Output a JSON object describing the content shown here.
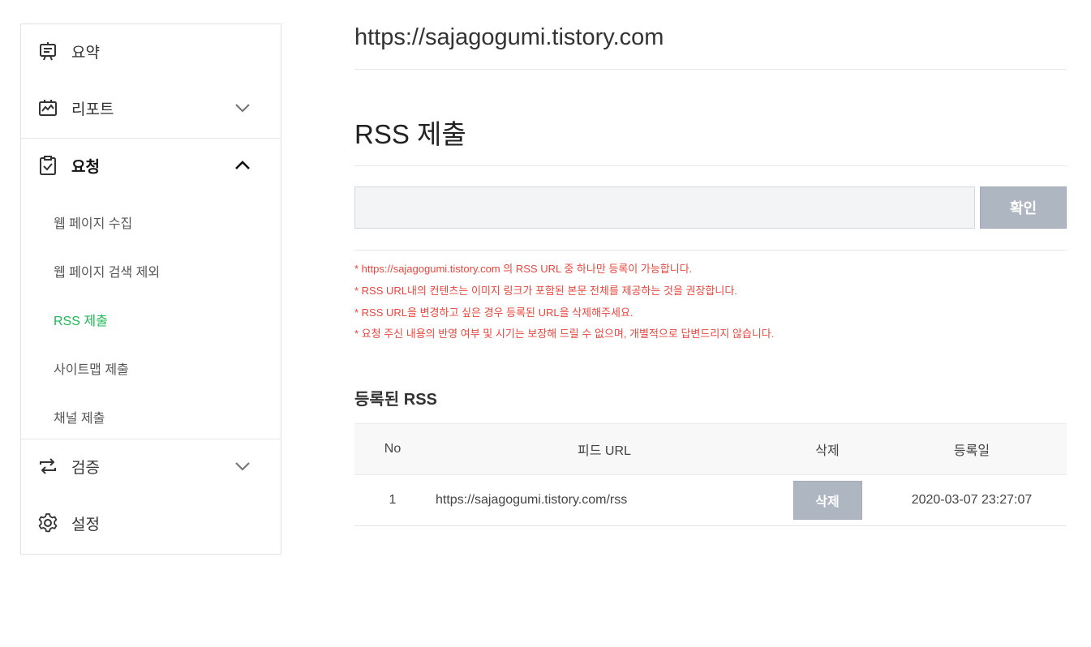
{
  "sidebar": {
    "items": [
      {
        "label": "요약",
        "icon": "presentation-board-icon"
      },
      {
        "label": "리포트",
        "icon": "chart-report-icon"
      },
      {
        "label": "요청",
        "icon": "clipboard-check-icon",
        "expanded": true
      },
      {
        "label": "검증",
        "icon": "repeat-arrows-icon"
      },
      {
        "label": "설정",
        "icon": "gear-icon"
      }
    ],
    "subitems": [
      "웹 페이지 수집",
      "웹 페이지 검색 제외",
      "RSS 제출",
      "사이트맵 제출",
      "채널 제출"
    ],
    "current_subitem_color": "#1db954"
  },
  "main": {
    "site_url": "https://sajagogumi.tistory.com",
    "page_title": "RSS 제출",
    "input": {
      "value": "",
      "placeholder": ""
    },
    "confirm_label": "확인",
    "notices": [
      "* https://sajagogumi.tistory.com 의 RSS URL 중 하나만 등록이 가능합니다.",
      "* RSS URL내의 컨텐츠는 이미지 링크가 포함된 본문 전체를 제공하는 것을 권장합니다.",
      "* RSS URL을 변경하고 싶은 경우 등록된 URL을 삭제해주세요.",
      "* 요청 주신 내용의 반영 여부 및 시기는 보장해 드릴 수 없으며, 개별적으로 답변드리지 않습니다."
    ],
    "notice_color": "#e8473e",
    "registered_title": "등록된 RSS",
    "table": {
      "headers": [
        "No",
        "피드 URL",
        "삭제",
        "등록일"
      ],
      "rows": [
        {
          "no": "1",
          "url": "https://sajagogumi.tistory.com/rss",
          "delete_label": "삭제",
          "date": "2020-03-07 23:27:07"
        }
      ]
    }
  }
}
